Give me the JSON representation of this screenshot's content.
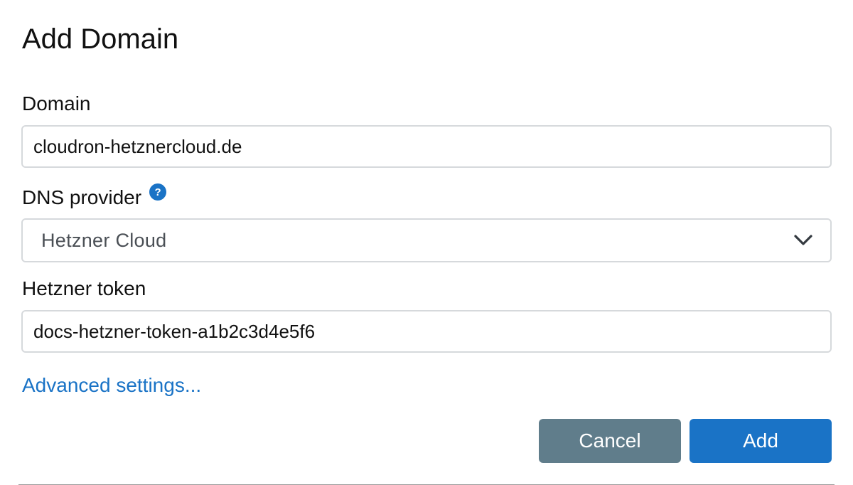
{
  "dialog": {
    "title": "Add Domain"
  },
  "form": {
    "domain": {
      "label": "Domain",
      "value": "cloudron-hetznercloud.de"
    },
    "dns_provider": {
      "label": "DNS provider",
      "help_icon_glyph": "?",
      "selected": "Hetzner Cloud"
    },
    "token": {
      "label": "Hetzner token",
      "value": "docs-hetzner-token-a1b2c3d4e5f6"
    },
    "advanced_link": "Advanced settings..."
  },
  "actions": {
    "cancel_label": "Cancel",
    "add_label": "Add"
  },
  "colors": {
    "primary": "#1a73c6",
    "secondary": "#607d8b",
    "input_border": "#d6d9dc"
  }
}
